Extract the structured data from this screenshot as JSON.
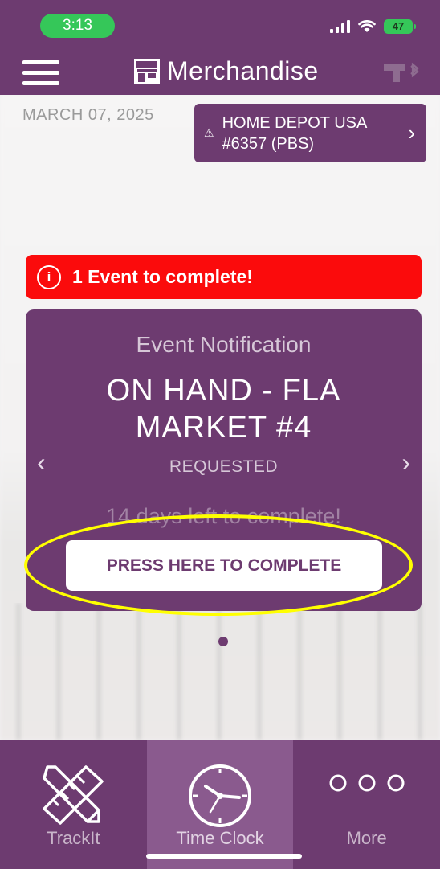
{
  "status_bar": {
    "time": "3:13",
    "battery": "47"
  },
  "header": {
    "title": "Merchandise",
    "icons": [
      "menu-icon",
      "store-icon",
      "scanner-bluetooth-icon"
    ]
  },
  "location": {
    "date": "MARCH 07, 2025",
    "store_line1": "HOME DEPOT USA",
    "store_line2": "#6357 (PBS)",
    "warning_glyph": "⚠",
    "chevron": "›"
  },
  "alert": {
    "icon_glyph": "i",
    "text": "1 Event to complete!",
    "color": "#fb0b0c"
  },
  "event_card": {
    "heading": "Event Notification",
    "title": "ON HAND - FLA MARKET #4",
    "status": "REQUESTED",
    "days_left": "14 days left to complete!",
    "button_label": "PRESS HERE TO COMPLETE",
    "prev_arrow": "‹",
    "next_arrow": "›"
  },
  "carousel": {
    "page": 1,
    "total": 1
  },
  "tab_bar": {
    "tabs": [
      {
        "label": "TrackIt",
        "icon": "ruler-pencil-icon",
        "active": false
      },
      {
        "label": "Time Clock",
        "icon": "clock-icon",
        "active": true
      },
      {
        "label": "More",
        "icon": "more-dots-icon",
        "active": false
      }
    ]
  },
  "colors": {
    "brand_purple": "#6d3b70",
    "active_tab": "#8a5a8e",
    "highlight": "#ffff00",
    "status_green": "#35c759"
  }
}
